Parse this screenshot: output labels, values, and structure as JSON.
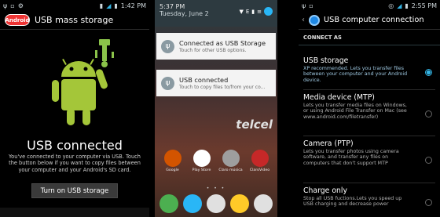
{
  "panel1": {
    "status_time": "1:42 PM",
    "logo_text": "Android",
    "title": "USB mass storage",
    "status_heading": "USB connected",
    "description": "You've connected to your computer via USB. Touch the button below if you want to copy files between your computer and your Android's SD card.",
    "button_label": "Turn on USB storage"
  },
  "panel2": {
    "time": "5:37 PM",
    "date": "Tuesday, June 2",
    "notifications": [
      {
        "title": "Connected as USB Storage",
        "subtitle": "Touch for other USB options."
      },
      {
        "title": "USB connected",
        "subtitle": "Touch to copy files to/from your co..."
      }
    ],
    "brand": "telcel",
    "apps": [
      {
        "label": "Google",
        "color": "#d35400"
      },
      {
        "label": "Play Store",
        "color": "#ffffff"
      },
      {
        "label": "Claro música",
        "color": "#9e9e9e"
      },
      {
        "label": "ClaroVideo",
        "color": "#c62828"
      }
    ],
    "dock_colors": [
      "#4caf50",
      "#29b6f6",
      "#e0e0e0",
      "#ffca28",
      "#e0e0e0"
    ],
    "page_dots": "• • •"
  },
  "panel3": {
    "status_time": "2:55 PM",
    "title": "USB computer connection",
    "section": "CONNECT AS",
    "options": [
      {
        "title": "USB storage",
        "desc": "XP recommended. Lets you transfer files between your computer and your Android device.",
        "selected": true
      },
      {
        "title": "Media device (MTP)",
        "desc": "Lets you transfer media files on Windows, or using Android File Transfer on Mac (see www.android.com/filetransfer)",
        "selected": false
      },
      {
        "title": "Camera (PTP)",
        "desc": "Lets you transfer photos using camera software, and transfer any files on computers that don't support MTP",
        "selected": false
      },
      {
        "title": "Charge only",
        "desc": "Stop all USB fuctions.Lets you speed up USB charging and decrease power",
        "selected": false
      }
    ]
  }
}
